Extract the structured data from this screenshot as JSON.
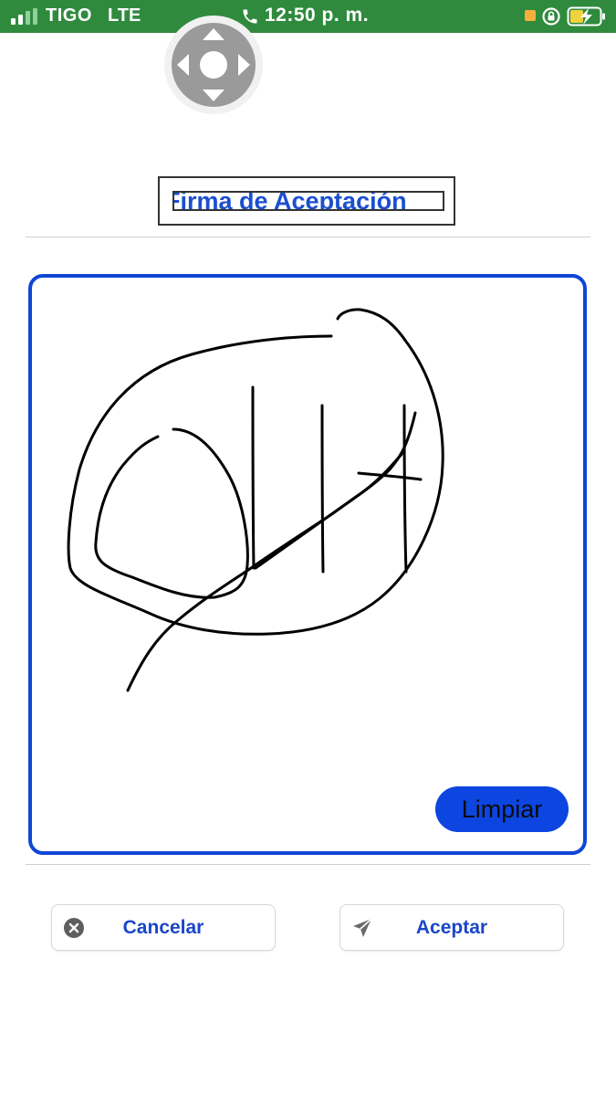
{
  "status_bar": {
    "carrier": "TIGO",
    "network": "LTE",
    "time": "12:50 p. m.",
    "icons": [
      "signal-icon",
      "phone-icon",
      "notification-dot",
      "rotation-lock-icon",
      "battery-charging-icon"
    ],
    "colors": {
      "background": "#2f8a3e",
      "notification": "#f4b03a",
      "battery": "#f2d23c"
    }
  },
  "assistive_touch": {
    "icon": "dpad-icon"
  },
  "header": {
    "title": "Firma de Aceptación"
  },
  "signature_pad": {
    "border_color": "#0f46d6",
    "clear_label": "Limpiar"
  },
  "actions": {
    "cancel": {
      "label": "Cancelar",
      "icon": "close-circle-icon"
    },
    "accept": {
      "label": "Aceptar",
      "icon": "send-icon"
    }
  },
  "colors": {
    "accent": "#1a46c8",
    "clear_button": "#0d45e0"
  }
}
